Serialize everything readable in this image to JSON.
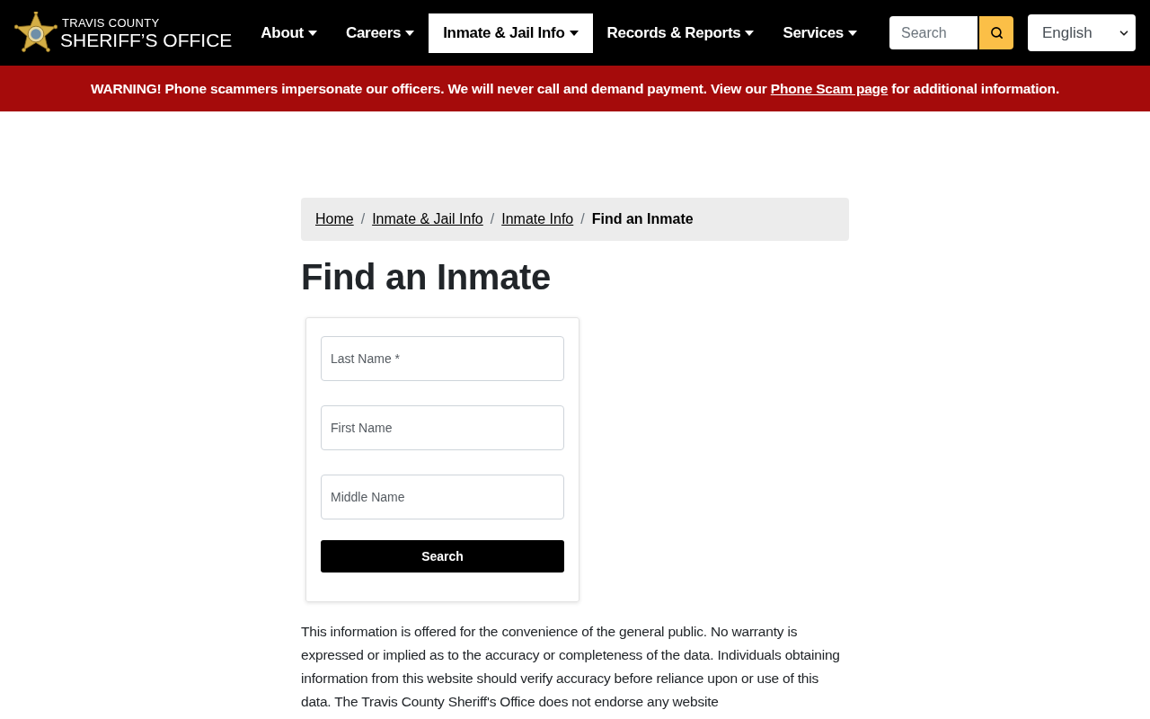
{
  "header": {
    "logo": {
      "line_1": "TRAVIS COUNTY",
      "line_2": "SHERIFF’S OFFICE"
    },
    "nav": [
      {
        "label": "About",
        "selected": false
      },
      {
        "label": "Careers",
        "selected": false
      },
      {
        "label": "Inmate & Jail Info",
        "selected": true
      },
      {
        "label": "Records & Reports",
        "selected": false
      },
      {
        "label": "Services",
        "selected": false
      }
    ],
    "search": {
      "placeholder": "Search"
    },
    "language_select": {
      "value": "English"
    }
  },
  "alert": {
    "text_before": "WARNING! Phone scammers impersonate our officers. We will never call and demand payment. View our ",
    "link": "Phone Scam page",
    "text_after": " for additional information."
  },
  "breadcrumb": {
    "separator": "/",
    "items": [
      {
        "label": "Home",
        "current": false
      },
      {
        "label": "Inmate & Jail Info",
        "current": false
      },
      {
        "label": "Inmate Info",
        "current": false
      },
      {
        "label": "Find an Inmate",
        "current": true
      }
    ]
  },
  "title": "Find an Inmate",
  "form": {
    "fields": [
      {
        "placeholder": "Last Name *"
      },
      {
        "placeholder": "First Name"
      },
      {
        "placeholder": "Middle Name"
      }
    ],
    "submit": "Search"
  },
  "disclaimer": "This information is offered for the convenience of the general public. No warranty is expressed or implied as to the accuracy or completeness of the data. Individuals obtaining information from this website should verify accuracy before reliance upon or use of this data. The Travis County Sheriff's Office does not endorse any website"
}
